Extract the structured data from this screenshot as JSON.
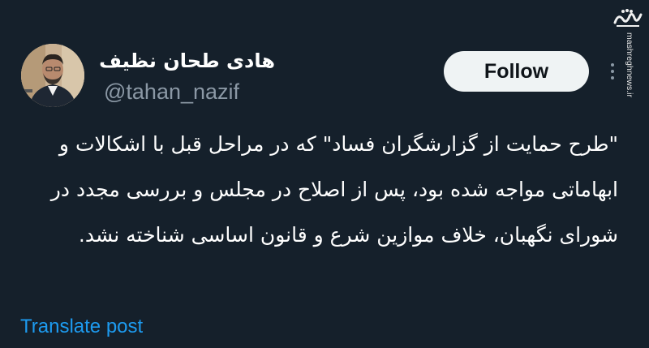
{
  "tweet": {
    "display_name": "هادی طحان نظیف",
    "username": "@tahan_nazif",
    "follow_label": "Follow",
    "more_icon": "more-horizontal-icon",
    "text": "\"طرح حمایت از گزارشگران فساد\" که در مراحل قبل با اشکالات و ابهاماتی مواجه شده بود، پس از اصلاح در مجلس و بررسی مجدد در شورای نگهبان، خلاف موازین شرع و قانون اساسی شناخته نشد.",
    "translate_label": "Translate post"
  },
  "watermark": {
    "logo_text": "مشرق",
    "site": "mashreghnews.ir"
  },
  "colors": {
    "background": "#15202b",
    "primary_text": "#ffffff",
    "secondary_text": "#8b98a5",
    "link": "#1d9bf0",
    "follow_button_bg": "#eff3f4",
    "follow_button_text": "#0f1419"
  }
}
